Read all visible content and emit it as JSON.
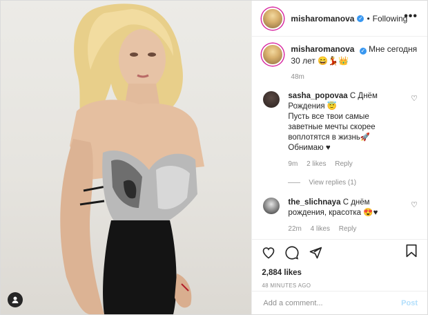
{
  "post": {
    "username": "misharomanova",
    "following_label": "Following",
    "more_label": "•••"
  },
  "caption": {
    "username": "misharomanova",
    "text": "Мне сегодня 30 лет 😄💃👑",
    "time": "48m"
  },
  "comments": [
    {
      "username": "sasha_popovaa",
      "text": "С Днём Рождения 😇",
      "text2": "Пусть все твои самые заветные мечты скорее воплотятся в жизнь🚀",
      "text3": "Обнимаю ♥",
      "time": "9m",
      "likes": "2 likes",
      "reply": "Reply",
      "view_replies": "View replies (1)"
    },
    {
      "username": "the_slichnaya",
      "text": "С днём рождения, красотка 😍♥",
      "time": "22m",
      "likes": "4 likes",
      "reply": "Reply"
    }
  ],
  "stats": {
    "likes": "2,884 likes",
    "posted_ago": "48 MINUTES AGO"
  },
  "add_comment": {
    "placeholder": "Add a comment...",
    "post_label": "Post"
  },
  "icons": {
    "heart": "heart-icon",
    "comment": "comment-icon",
    "share": "share-icon",
    "bookmark": "bookmark-icon"
  },
  "colors": {
    "verified": "#3897f0",
    "post_disabled": "#b2dffc",
    "muted": "#8e8e8e"
  }
}
